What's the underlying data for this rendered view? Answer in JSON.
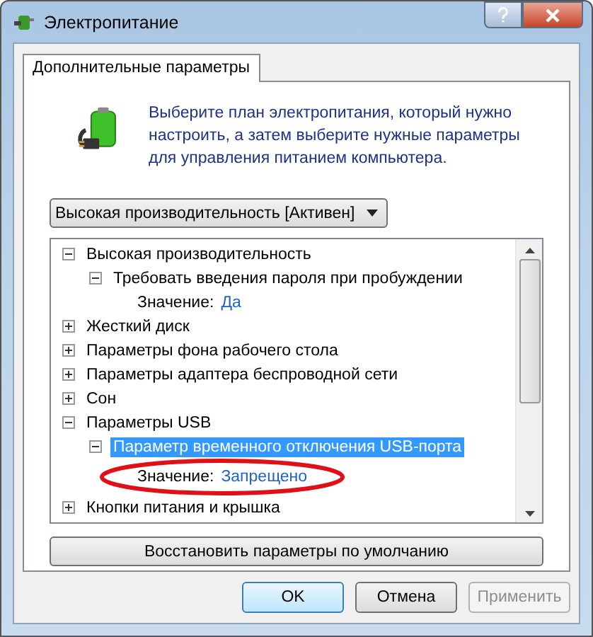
{
  "window": {
    "title": "Электропитание"
  },
  "tabs": [
    {
      "label": "Дополнительные параметры",
      "selected": true
    }
  ],
  "description": "Выберите план электропитания, который нужно настроить, а затем выберите нужные параметры для управления питанием компьютера.",
  "plan_dropdown": {
    "value": "Высокая производительность [Активен]"
  },
  "tree": [
    {
      "kind": "group",
      "label": "Высокая производительность",
      "expanded": true,
      "selected": false,
      "children": [
        {
          "kind": "group",
          "label": "Требовать введения пароля при пробуждении",
          "expanded": true,
          "selected": false,
          "children": [
            {
              "kind": "setting",
              "label": "Значение:",
              "value": "Да",
              "selected": false,
              "circled": false
            }
          ]
        }
      ]
    },
    {
      "kind": "group",
      "label": "Жесткий диск",
      "expanded": false,
      "selected": false
    },
    {
      "kind": "group",
      "label": "Параметры фона рабочего стола",
      "expanded": false,
      "selected": false
    },
    {
      "kind": "group",
      "label": "Параметры адаптера беспроводной сети",
      "expanded": false,
      "selected": false
    },
    {
      "kind": "group",
      "label": "Сон",
      "expanded": false,
      "selected": false
    },
    {
      "kind": "group",
      "label": "Параметры USB",
      "expanded": true,
      "selected": false,
      "children": [
        {
          "kind": "group",
          "label": "Параметр временного отключения USB-порта",
          "expanded": true,
          "selected": true,
          "children": [
            {
              "kind": "setting",
              "label": "Значение:",
              "value": "Запрещено",
              "selected": false,
              "circled": true
            }
          ]
        }
      ]
    },
    {
      "kind": "group",
      "label": "Кнопки питания и крышка",
      "expanded": false,
      "selected": false
    }
  ],
  "restore_button": "Восстановить параметры по умолчанию",
  "buttons": [
    {
      "label": "OK",
      "disabled": false,
      "default": true
    },
    {
      "label": "Отмена",
      "disabled": false,
      "default": false
    },
    {
      "label": "Применить",
      "disabled": true,
      "default": false
    }
  ]
}
